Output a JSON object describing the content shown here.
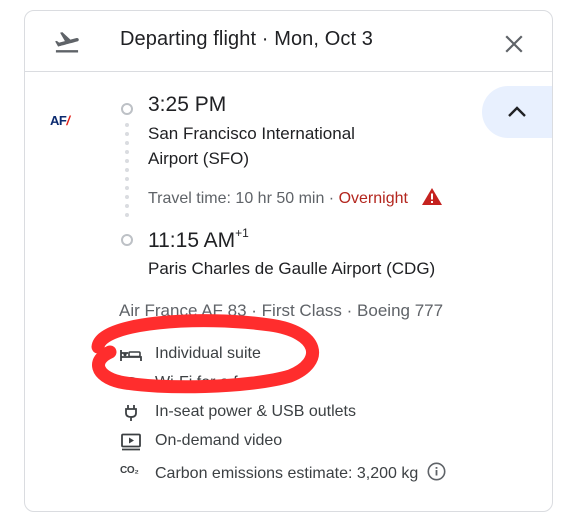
{
  "header": {
    "title": "Departing flight · Mon, Oct 3",
    "icon_left": "flight-takeoff-icon",
    "icon_right": "close-icon"
  },
  "airline": {
    "logo_text": "AF",
    "logo_accent": "/",
    "logo_color": "#0b2a6f",
    "accent_color": "#e2231a"
  },
  "departure": {
    "time": "3:25 PM",
    "airport_line1": "San Francisco International",
    "airport_line2": "Airport (SFO)"
  },
  "travel": {
    "label": "Travel time: 10 hr 50 min",
    "separator": " · ",
    "overnight": "Overnight",
    "overnight_color": "#b3261e"
  },
  "arrival": {
    "time": "11:15 AM",
    "day_offset": "+1",
    "airport": "Paris Charles de Gaulle Airport (CDG)"
  },
  "flight_info": "Air France AF 83 · First Class · Boeing 777",
  "amenities": [
    {
      "icon": "individual-suite-icon",
      "label": "Individual suite"
    },
    {
      "icon": "wifi-icon",
      "label": "Wi-Fi for a fee"
    },
    {
      "icon": "power-plug-icon",
      "label": "In-seat power & USB outlets"
    },
    {
      "icon": "video-icon",
      "label": "On-demand video"
    },
    {
      "icon": "co2-icon",
      "label": "Carbon emissions estimate: 3,200 kg"
    }
  ],
  "co2_icon_text": "CO₂",
  "colors": {
    "accent_bg": "#e8f0fe",
    "annotation": "#ff2d2d"
  }
}
